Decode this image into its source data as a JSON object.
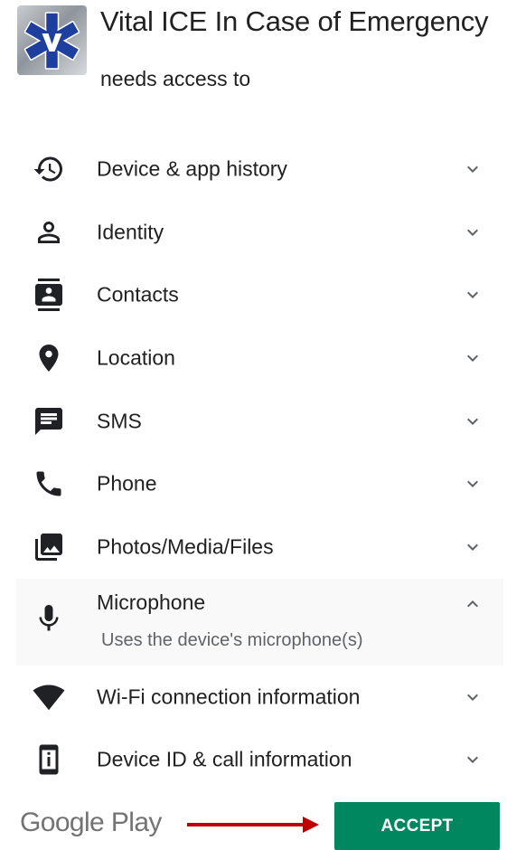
{
  "app": {
    "title": "Vital ICE In Case of Emergency",
    "subtitle": "needs access to",
    "icon": "star-of-life-icon"
  },
  "permissions": [
    {
      "label": "Device & app history",
      "icon": "history-icon",
      "expanded": false
    },
    {
      "label": "Identity",
      "icon": "person-icon",
      "expanded": false
    },
    {
      "label": "Contacts",
      "icon": "contacts-icon",
      "expanded": false
    },
    {
      "label": "Location",
      "icon": "location-pin-icon",
      "expanded": false
    },
    {
      "label": "SMS",
      "icon": "message-icon",
      "expanded": false
    },
    {
      "label": "Phone",
      "icon": "phone-icon",
      "expanded": false
    },
    {
      "label": "Photos/Media/Files",
      "icon": "photo-library-icon",
      "expanded": false
    },
    {
      "label": "Microphone",
      "icon": "microphone-icon",
      "expanded": true,
      "description": "Uses the device's microphone(s)"
    },
    {
      "label": "Wi-Fi connection information",
      "icon": "wifi-icon",
      "expanded": false
    },
    {
      "label": "Device ID & call information",
      "icon": "device-id-icon",
      "expanded": false
    }
  ],
  "footer": {
    "brand": "Google Play",
    "accept_label": "ACCEPT",
    "accept_color": "#01875f",
    "arrow_color": "#c00000"
  },
  "colors": {
    "text": "#212121",
    "secondary": "#5f6368",
    "icon": "#202124",
    "chevron": "#5f6368",
    "star_blue": "#1f3f9f"
  }
}
